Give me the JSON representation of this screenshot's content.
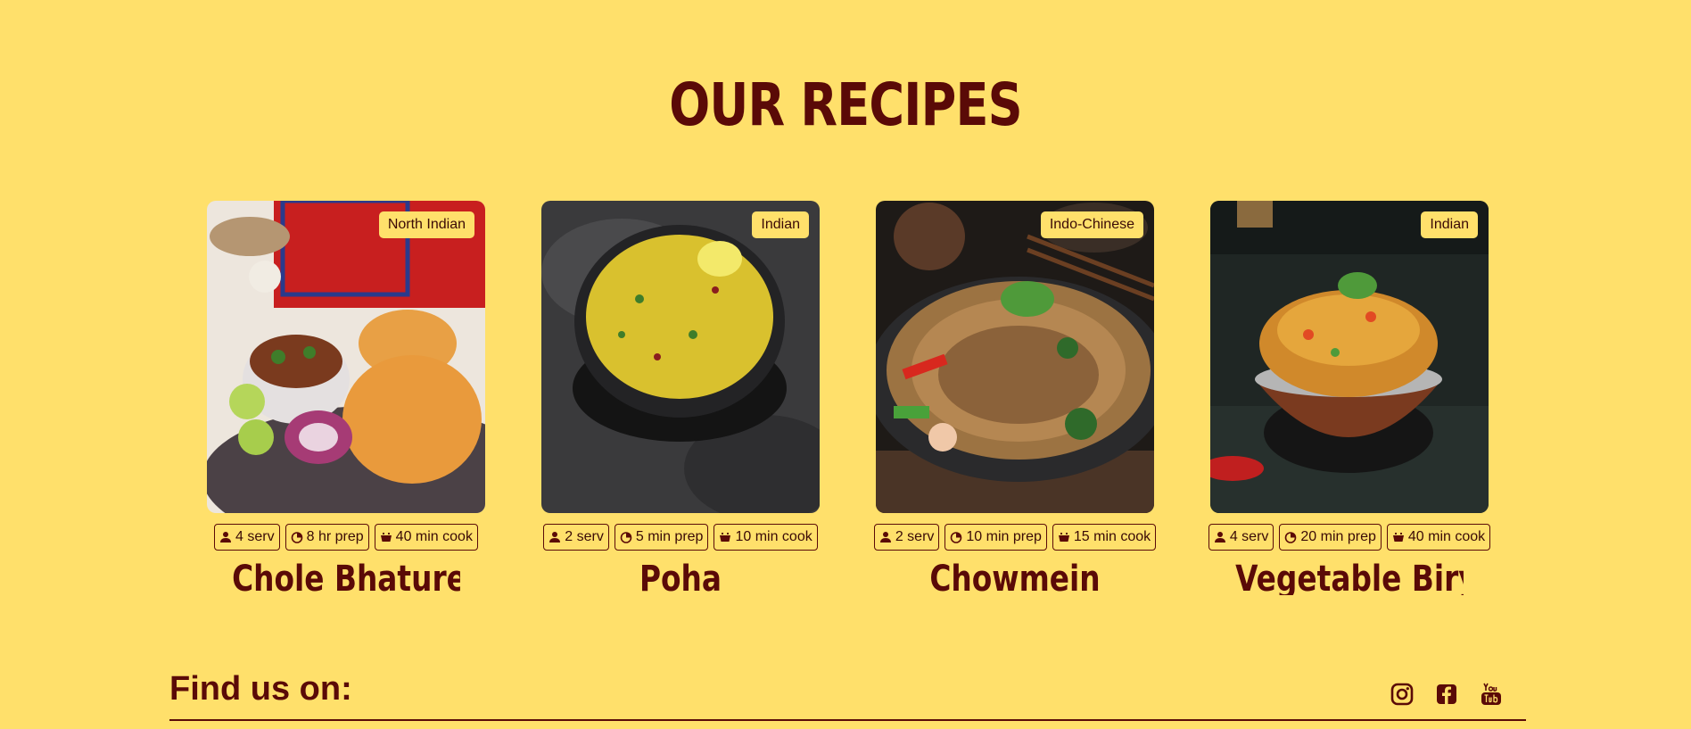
{
  "section": {
    "title": "OUR RECIPES"
  },
  "recipes": [
    {
      "name": "Chole Bhature",
      "cuisine": "North Indian",
      "servings": "4 serv",
      "prep": "8 hr prep",
      "cook": "40 min cook"
    },
    {
      "name": "Poha",
      "cuisine": "Indian",
      "servings": "2 serv",
      "prep": "5 min prep",
      "cook": "10 min cook"
    },
    {
      "name": "Chowmein",
      "cuisine": "Indo-Chinese",
      "servings": "2 serv",
      "prep": "10 min prep",
      "cook": "15 min cook"
    },
    {
      "name": "Vegetable Biryani",
      "cuisine": "Indian",
      "servings": "4 serv",
      "prep": "20 min prep",
      "cook": "40 min cook"
    }
  ],
  "footer": {
    "title": "Find us on:",
    "social": [
      {
        "name": "instagram-icon"
      },
      {
        "name": "facebook-icon"
      },
      {
        "name": "youtube-icon"
      }
    ]
  },
  "colors": {
    "background": "#FFE06B",
    "primary": "#5A0A07"
  }
}
